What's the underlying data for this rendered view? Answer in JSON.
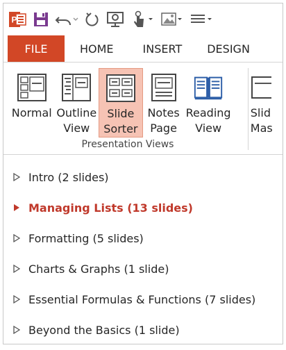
{
  "qat": {
    "items": [
      {
        "name": "app-logo",
        "icon": "powerpoint-logo-icon"
      },
      {
        "name": "save",
        "icon": "save-icon"
      },
      {
        "name": "undo",
        "icon": "undo-icon"
      },
      {
        "name": "redo",
        "icon": "redo-icon"
      },
      {
        "name": "presenter",
        "icon": "presenter-view-icon"
      },
      {
        "name": "touch-mode",
        "icon": "touch-mode-icon"
      },
      {
        "name": "picture",
        "icon": "picture-icon"
      },
      {
        "name": "customize",
        "icon": "customize-qat-icon"
      }
    ]
  },
  "tabs": [
    {
      "label": "FILE",
      "active": true
    },
    {
      "label": "HOME"
    },
    {
      "label": "INSERT"
    },
    {
      "label": "DESIGN"
    }
  ],
  "ribbon": {
    "group_label": "Presentation Views",
    "views": [
      {
        "label": "Normal",
        "icon": "normal-view-icon"
      },
      {
        "label": "Outline\nView",
        "icon": "outline-view-icon"
      },
      {
        "label": "Slide\nSorter",
        "icon": "slide-sorter-icon",
        "active": true
      },
      {
        "label": "Notes\nPage",
        "icon": "notes-page-icon"
      },
      {
        "label": "Reading\nView",
        "icon": "reading-view-icon"
      },
      {
        "label": "Slid\nMas",
        "icon": "slide-master-icon"
      }
    ]
  },
  "sections": [
    {
      "label": "Intro (2 slides)"
    },
    {
      "label": "Managing Lists (13 slides)",
      "active": true
    },
    {
      "label": "Formatting (5 slides)"
    },
    {
      "label": "Charts & Graphs (1 slide)"
    },
    {
      "label": "Essential Formulas & Functions (7 slides)"
    },
    {
      "label": "Beyond the Basics (1 slide)"
    }
  ],
  "colors": {
    "accent": "#d24726",
    "active_section": "#c0392b",
    "active_view_bg": "#f6c3b4"
  }
}
